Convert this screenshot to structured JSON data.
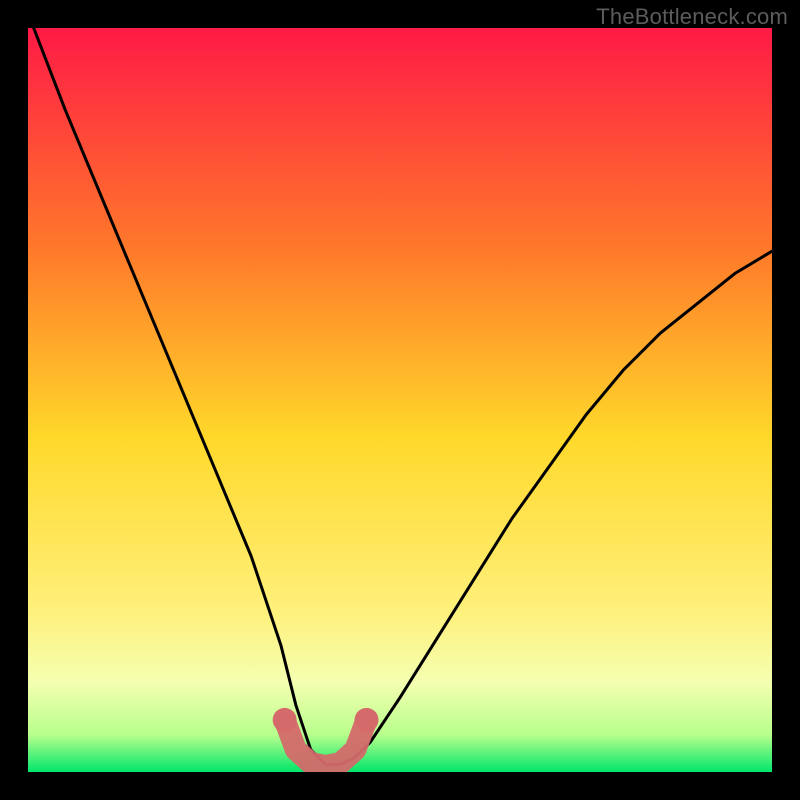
{
  "watermark": "TheBottleneck.com",
  "colors": {
    "page_bg": "#000000",
    "gradient_top": "#ff1a46",
    "gradient_mid_upper": "#ff8a1f",
    "gradient_mid": "#ffe02a",
    "gradient_mid_lower": "#fff69a",
    "gradient_bottom": "#00e66a",
    "curve": "#000000",
    "highlight": "#d46a6a"
  },
  "chart_data": {
    "type": "line",
    "title": "",
    "xlabel": "",
    "ylabel": "",
    "xlim": [
      0,
      100
    ],
    "ylim": [
      0,
      100
    ],
    "series": [
      {
        "name": "bottleneck-curve",
        "x": [
          0,
          5,
          10,
          15,
          20,
          25,
          30,
          34,
          36,
          38,
          40,
          42,
          44,
          46,
          50,
          55,
          60,
          65,
          70,
          75,
          80,
          85,
          90,
          95,
          100
        ],
        "values": [
          102,
          89,
          77,
          65,
          53,
          41,
          29,
          17,
          9,
          3,
          1,
          1,
          2,
          4,
          10,
          18,
          26,
          34,
          41,
          48,
          54,
          59,
          63,
          67,
          70
        ]
      }
    ],
    "highlight_region": {
      "x": [
        34.5,
        36,
        38,
        40,
        42,
        44,
        45.5
      ],
      "values": [
        7,
        3,
        1.2,
        0.8,
        1.2,
        3,
        7
      ]
    },
    "grid": false,
    "legend": false
  }
}
